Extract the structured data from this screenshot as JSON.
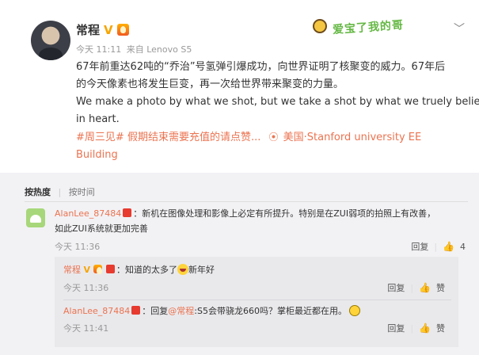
{
  "post": {
    "author": "常程",
    "meta_time": "今天 11:11",
    "meta_source": "来自 Lenovo S5",
    "body_lines": [
      "67年前重达62吨的“乔治”号氢弹引爆成功，向世界证明了核聚变的威力。67年后",
      "的今天像素也将发生巨变，再一次给世界带来聚变的力量。",
      "We make a photo by what we shot, but we take a shot by what we truely believe",
      "in heart."
    ],
    "hashtag": "#周三见#",
    "tag_text": "假期结束需要充值的请点赞...",
    "location_icon": "location-icon",
    "location": "美国·Stanford university EE",
    "location_tail": "Building",
    "decor_text": "爱宝了我的哥"
  },
  "comments_section": {
    "sort_hot": "按热度",
    "sort_time": "按时间",
    "comment": {
      "user": "AlanLee_87484",
      "text": "：新机在图像处理和影像上必定有所提升。特别是在ZUI弱项的拍照上有改善，",
      "text2": "如此ZUI系统就更加完善",
      "time": "今天 11:36",
      "reply_label": "回复",
      "like_count": "4"
    },
    "replies": [
      {
        "user": "常程",
        "text": "：知道的太多了",
        "text_tail": "新年好",
        "time": "今天 11:36",
        "reply_label": "回复",
        "like_label": "赞"
      },
      {
        "user": "AlanLee_87484",
        "text_prefix": "：回复",
        "mention": "@常程",
        "text": ":S5会带骁龙660吗？掌柜最近都在用。",
        "time": "今天 11:41",
        "reply_label": "回复",
        "like_label": "赞"
      }
    ]
  },
  "colors": {
    "accent": "#eb7350",
    "verified": "#f7a500"
  }
}
